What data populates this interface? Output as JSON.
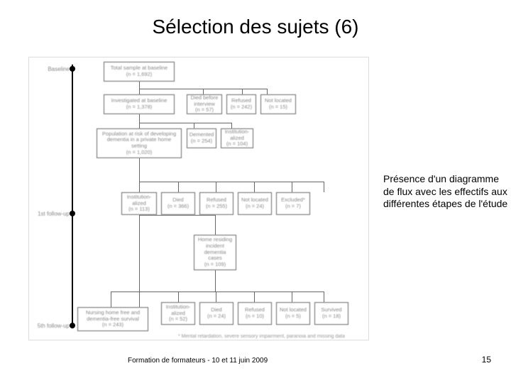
{
  "title": "Sélection des sujets (6)",
  "annotation": "Présence d'un diagramme de flux avec les effectifs aux différentes étapes de l'étude",
  "footer_left": "Formation de formateurs - 10 et 11 juin 2009",
  "footer_right": "15",
  "timeline": {
    "baseline": "Baseline",
    "first": "1st follow-up",
    "fifth": "5th follow-up"
  },
  "boxes": {
    "total": {
      "label": "Total sample at baseline",
      "n": "(n = 1,692)"
    },
    "invest": {
      "label": "Investigated at baseline",
      "n": "(n = 1,378)"
    },
    "died1": {
      "label": "Died before interview",
      "n": "(n = 57)"
    },
    "refused1": {
      "label": "Refused",
      "n": "(n = 242)"
    },
    "notloc1": {
      "label": "Not located",
      "n": "(n = 15)"
    },
    "poprisk": {
      "label": "Population at risk of developing dementia in a private home setting",
      "n": "(n = 1,020)"
    },
    "demented": {
      "label": "Demented",
      "n": "(n = 254)"
    },
    "inst1": {
      "label": "Institution-alized",
      "n": "(n = 104)"
    },
    "inst2": {
      "label": "Institution-alized",
      "n": "(n = 113)"
    },
    "died2": {
      "label": "Died",
      "n": "(n = 366)"
    },
    "refused2": {
      "label": "Refused",
      "n": "(n = 255)"
    },
    "notloc2": {
      "label": "Not located",
      "n": "(n = 24)"
    },
    "excluded": {
      "label": "Excluded*",
      "n": "(n = 7)"
    },
    "homeres": {
      "label": "Home residing incident dementia cases",
      "n": "(n = 109)"
    },
    "nursing": {
      "label": "Nursing home free and dementia-free survival",
      "n": "(n = 243)"
    },
    "inst3": {
      "label": "Institution-alized",
      "n": "(n = 52)"
    },
    "died3": {
      "label": "Died",
      "n": "(n = 24)"
    },
    "refused3": {
      "label": "Refused",
      "n": "(n = 10)"
    },
    "notloc3": {
      "label": "Not located",
      "n": "(n = 5)"
    },
    "survived": {
      "label": "Survived",
      "n": "(n = 18)"
    }
  },
  "footnote": "* Mental retardation, severe sensory impairment, paranoia and missing data"
}
